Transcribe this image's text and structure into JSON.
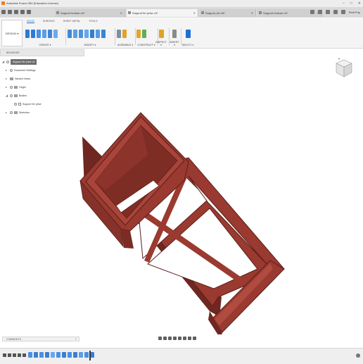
{
  "app": {
    "title": "Autodesk Fusion 360 (Education License)"
  },
  "tabs": [
    {
      "label": "Support bureau v4*",
      "active": false
    },
    {
      "label": "Support fer prise v4*",
      "active": true
    },
    {
      "label": "Support_fer v5*",
      "active": false
    },
    {
      "label": "Support Ivoiture v4*",
      "active": false
    }
  ],
  "user": {
    "name": "Petit Pop"
  },
  "ribbon": {
    "workspace": "DESIGN",
    "tabs": [
      "SOLID",
      "SURFACE",
      "SHEET METAL",
      "TOOLS"
    ],
    "groups": [
      "CREATE ▾",
      "MODIFY ▾",
      "ASSEMBLE ▾",
      "CONSTRUCT ▾",
      "INSPECT ▾",
      "INSERT ▾",
      "SELECT ▾"
    ]
  },
  "browser": {
    "title": "BROWSER",
    "root": "Support fer prise v4",
    "items": [
      "Document Settings",
      "Named Views",
      "Origin",
      "Bodies",
      "Support fer prise",
      "Sketches"
    ]
  },
  "comments": {
    "title": "COMMENTS"
  },
  "colors": {
    "accent": "#1f6fd1",
    "model": "#9b3a30",
    "model_dark": "#7a2a22",
    "model_light": "#b24a3c"
  }
}
